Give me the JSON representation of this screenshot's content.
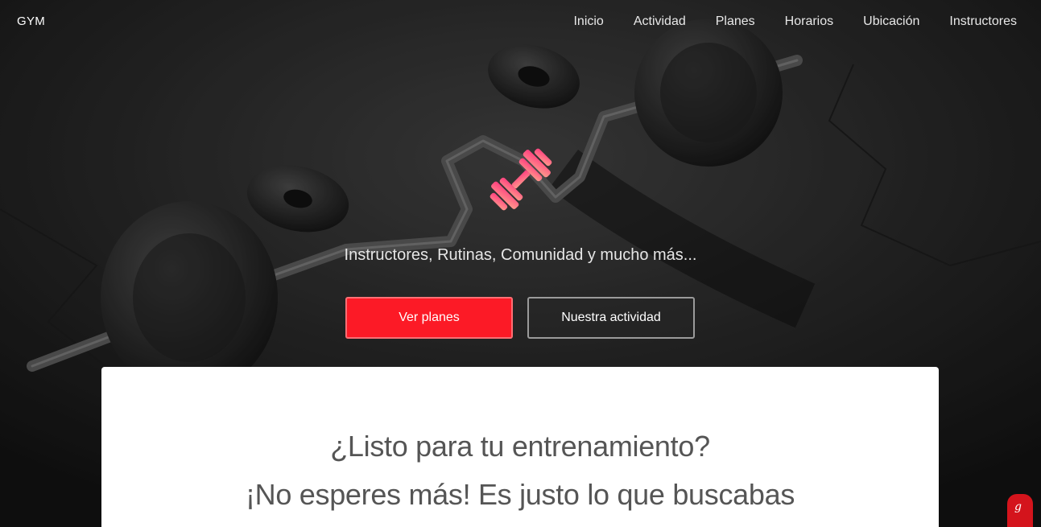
{
  "brand": "GYM",
  "nav": {
    "items": [
      "Inicio",
      "Actividad",
      "Planes",
      "Horarios",
      "Ubicación",
      "Instructores"
    ]
  },
  "hero": {
    "logo_icon": "dumbbell-icon",
    "tagline": "Instructores, Rutinas, Comunidad y mucho más...",
    "primary_button": "Ver planes",
    "secondary_button": "Nuestra actividad"
  },
  "card": {
    "title": "¿Listo para tu entrenamiento?",
    "subtitle": "¡No esperes más! Es justo lo que buscabas"
  },
  "chat_widget": {
    "icon": "chat-icon",
    "glyph": "g"
  },
  "colors": {
    "accent": "#fc1a26",
    "logo_gradient_start": "#ff9a8c",
    "logo_gradient_end": "#ff3d7f"
  }
}
